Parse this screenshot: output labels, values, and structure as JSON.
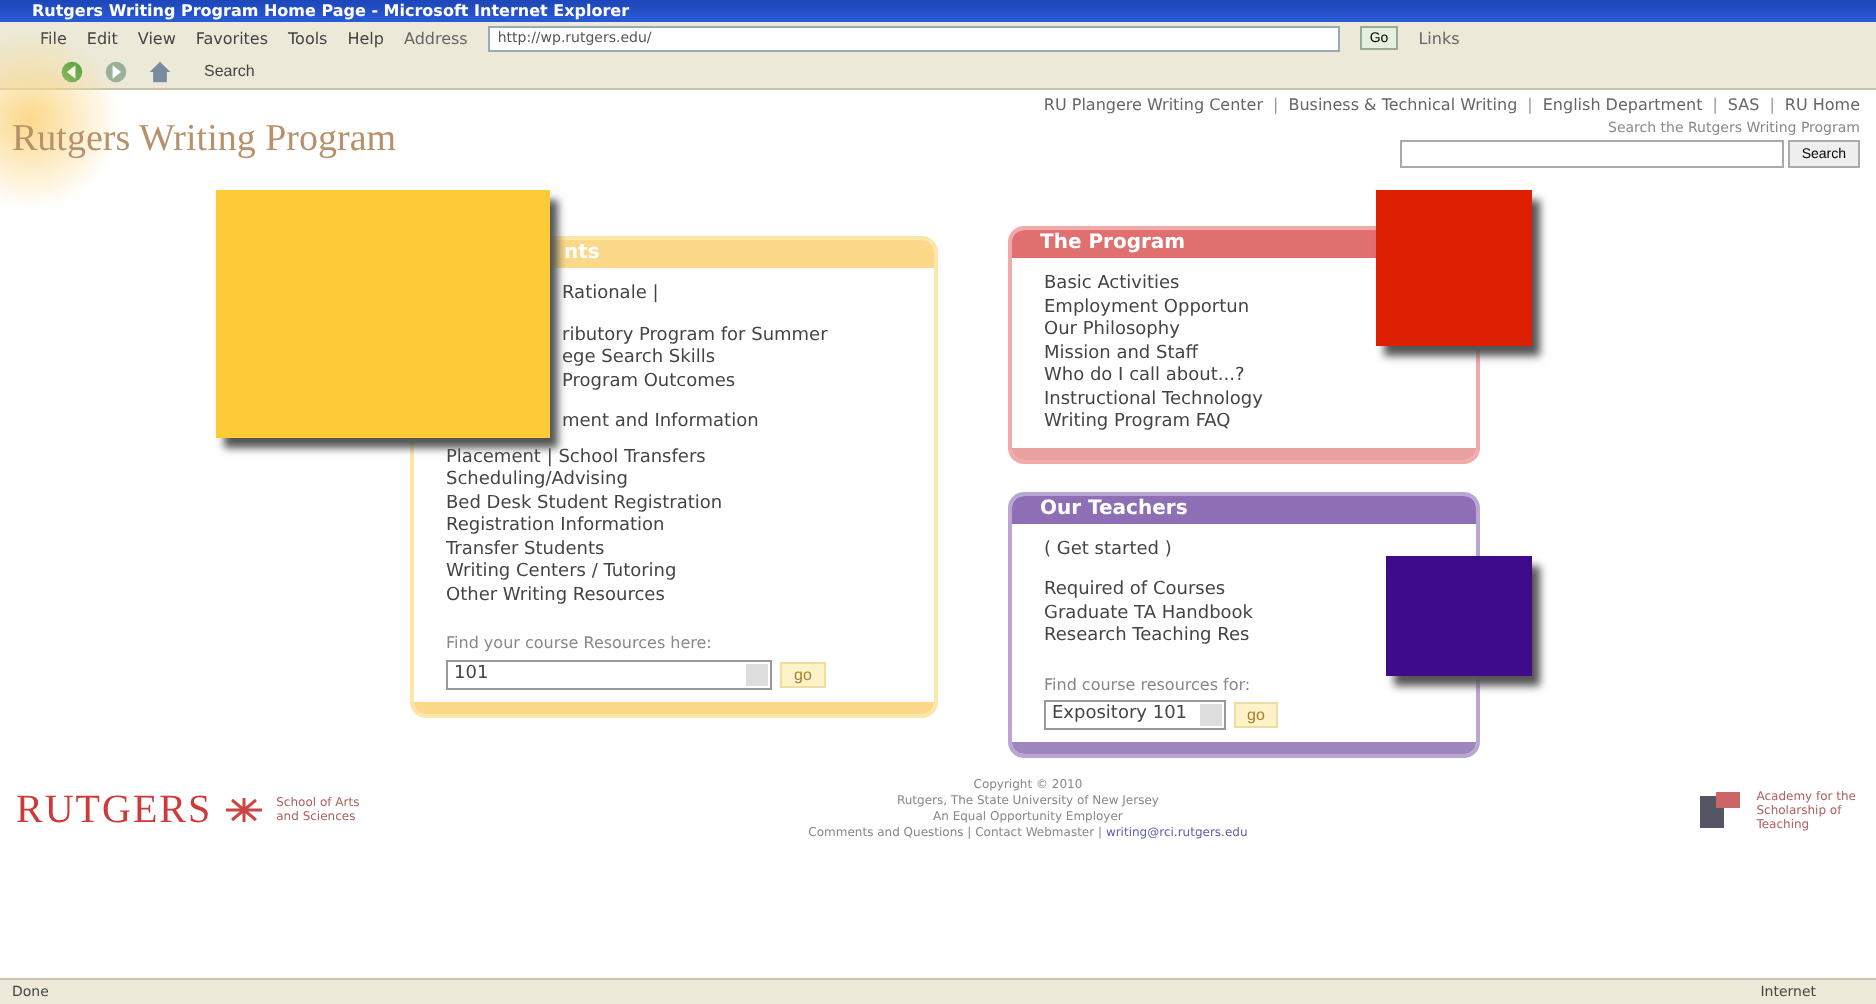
{
  "window": {
    "title": "Rutgers Writing Program Home Page - Microsoft Internet Explorer"
  },
  "menu": [
    "File",
    "Edit",
    "View",
    "Favorites",
    "Tools",
    "Help"
  ],
  "address": {
    "label": "Address",
    "value": "http://wp.rutgers.edu/",
    "go": "Go",
    "links": "Links"
  },
  "toolbar": {
    "search": "Search"
  },
  "top_separator": "|",
  "top_links": [
    "RU Plangere Writing Center",
    "Business & Technical Writing",
    "English Department",
    "SAS",
    "RU Home"
  ],
  "logo": "Rutgers Writing Program",
  "search": {
    "label": "Search the Rutgers Writing Program",
    "button": "Search"
  },
  "students": {
    "heading": "nts",
    "items": [
      "Rationale |",
      "ributory Program for Summer",
      "ege Search Skills",
      "Program Outcomes",
      "ment and Information",
      "Placement | School Transfers",
      "Scheduling/Advising",
      "Bed Desk Student Registration",
      "Registration Information",
      "Transfer Students",
      "Writing Centers / Tutoring",
      "Other Writing Resources"
    ],
    "find_label": "Find your course Resources here:",
    "select": "101",
    "go": "go"
  },
  "program": {
    "heading": "The Program",
    "items": [
      "Basic Activities",
      "Employment Opportun",
      "Our Philosophy",
      "Mission and Staff",
      "Who do I call about...?",
      "Instructional Technology",
      "Writing Program FAQ"
    ]
  },
  "teachers": {
    "heading": "Our Teachers",
    "intro": "( Get started )",
    "items": [
      "Required of Courses",
      "Graduate TA Handbook",
      "Research Teaching Res"
    ],
    "find_label": "Find course resources for:",
    "select": "Expository 101",
    "go": "go"
  },
  "footer": {
    "logo": "RUTGERS",
    "school": [
      "School of Arts",
      "and Sciences"
    ],
    "lines": [
      "Copyright © 2010",
      "Rutgers, The State University of New Jersey",
      "An Equal Opportunity Employer"
    ],
    "contact": "Comments and Questions | Contact Webmaster |",
    "email": "writing@rci.rutgers.edu",
    "academy": [
      "Academy for the",
      "Scholarship of",
      "Teaching"
    ]
  },
  "status_bar": {
    "text": "Done",
    "zone": "Internet"
  }
}
